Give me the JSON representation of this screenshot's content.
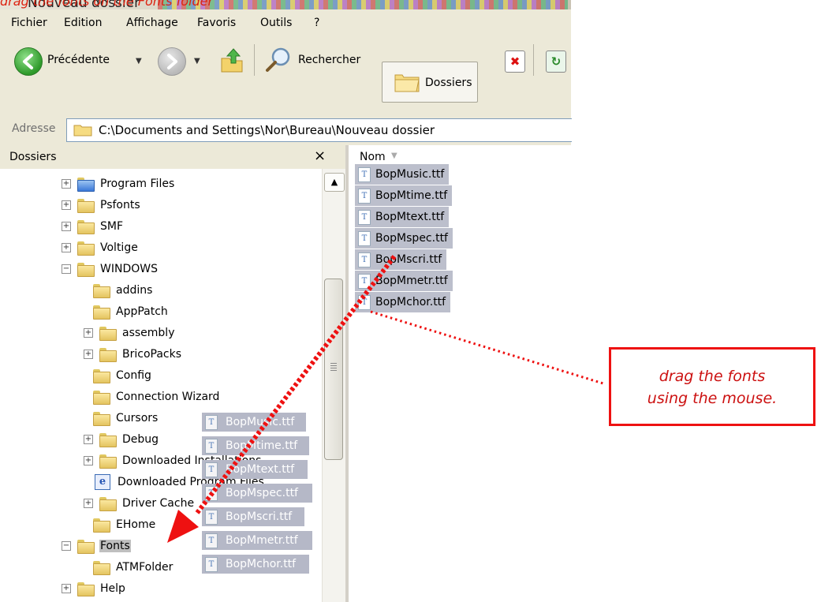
{
  "window": {
    "title": "Nouveau dossier",
    "overlay_title": "drag the fonts on the Fonts folder"
  },
  "menu": {
    "items": [
      "Fichier",
      "Edition",
      "Affichage",
      "Favoris",
      "Outils",
      "?"
    ]
  },
  "toolbar": {
    "back_label": "Précédente",
    "search_label": "Rechercher",
    "folders_label": "Dossiers"
  },
  "address": {
    "label": "Adresse",
    "path": "C:\\Documents and Settings\\Nor\\Bureau\\Nouveau dossier"
  },
  "folder_pane": {
    "title": "Dossiers",
    "close": "×",
    "tree": [
      {
        "label": "Program Files",
        "expander": "+",
        "icon": "folder-blue"
      },
      {
        "label": "Psfonts",
        "expander": "+",
        "icon": "folder"
      },
      {
        "label": "SMF",
        "expander": "+",
        "icon": "folder"
      },
      {
        "label": "Voltige",
        "expander": "+",
        "icon": "folder"
      },
      {
        "label": "WINDOWS",
        "expander": "−",
        "icon": "folder"
      },
      {
        "label": "addins",
        "expander": "",
        "icon": "folder"
      },
      {
        "label": "AppPatch",
        "expander": "",
        "icon": "folder"
      },
      {
        "label": "assembly",
        "expander": "+",
        "icon": "folder"
      },
      {
        "label": "BricoPacks",
        "expander": "+",
        "icon": "folder"
      },
      {
        "label": "Config",
        "expander": "",
        "icon": "folder"
      },
      {
        "label": "Connection Wizard",
        "expander": "",
        "icon": "folder"
      },
      {
        "label": "Cursors",
        "expander": "",
        "icon": "folder"
      },
      {
        "label": "Debug",
        "expander": "+",
        "icon": "folder"
      },
      {
        "label": "Downloaded Installations",
        "expander": "+",
        "icon": "folder"
      },
      {
        "label": "Downloaded Program Files",
        "expander": "",
        "icon": "ie"
      },
      {
        "label": "Driver Cache",
        "expander": "+",
        "icon": "folder"
      },
      {
        "label": "EHome",
        "expander": "",
        "icon": "folder"
      },
      {
        "label": "Fonts",
        "expander": "−",
        "icon": "folder",
        "selected": true
      },
      {
        "label": "ATMFolder",
        "expander": "",
        "icon": "folder"
      },
      {
        "label": "Help",
        "expander": "+",
        "icon": "folder"
      }
    ]
  },
  "file_list": {
    "column_name": "Nom",
    "files": [
      "BopMusic.ttf",
      "BopMtime.ttf",
      "BopMtext.ttf",
      "BopMspec.ttf",
      "BopMscri.ttf",
      "BopMmetr.ttf",
      "BopMchor.ttf"
    ]
  },
  "drag_ghost": {
    "files": [
      "BopMusic.ttf",
      "BopMtime.ttf",
      "BopMtext.ttf",
      "BopMspec.ttf",
      "BopMscri.ttf",
      "BopMmetr.ttf",
      "BopMchor.ttf"
    ]
  },
  "annotation": {
    "note": "drag the fonts\nusing the mouse."
  },
  "icons": {
    "file_icon": "ttf-font-icon",
    "folder_icon": "folder-icon"
  },
  "colors": {
    "annotation_red": "#e11111",
    "selection_gray": "#bcbfcc",
    "chrome": "#ece9d8"
  }
}
